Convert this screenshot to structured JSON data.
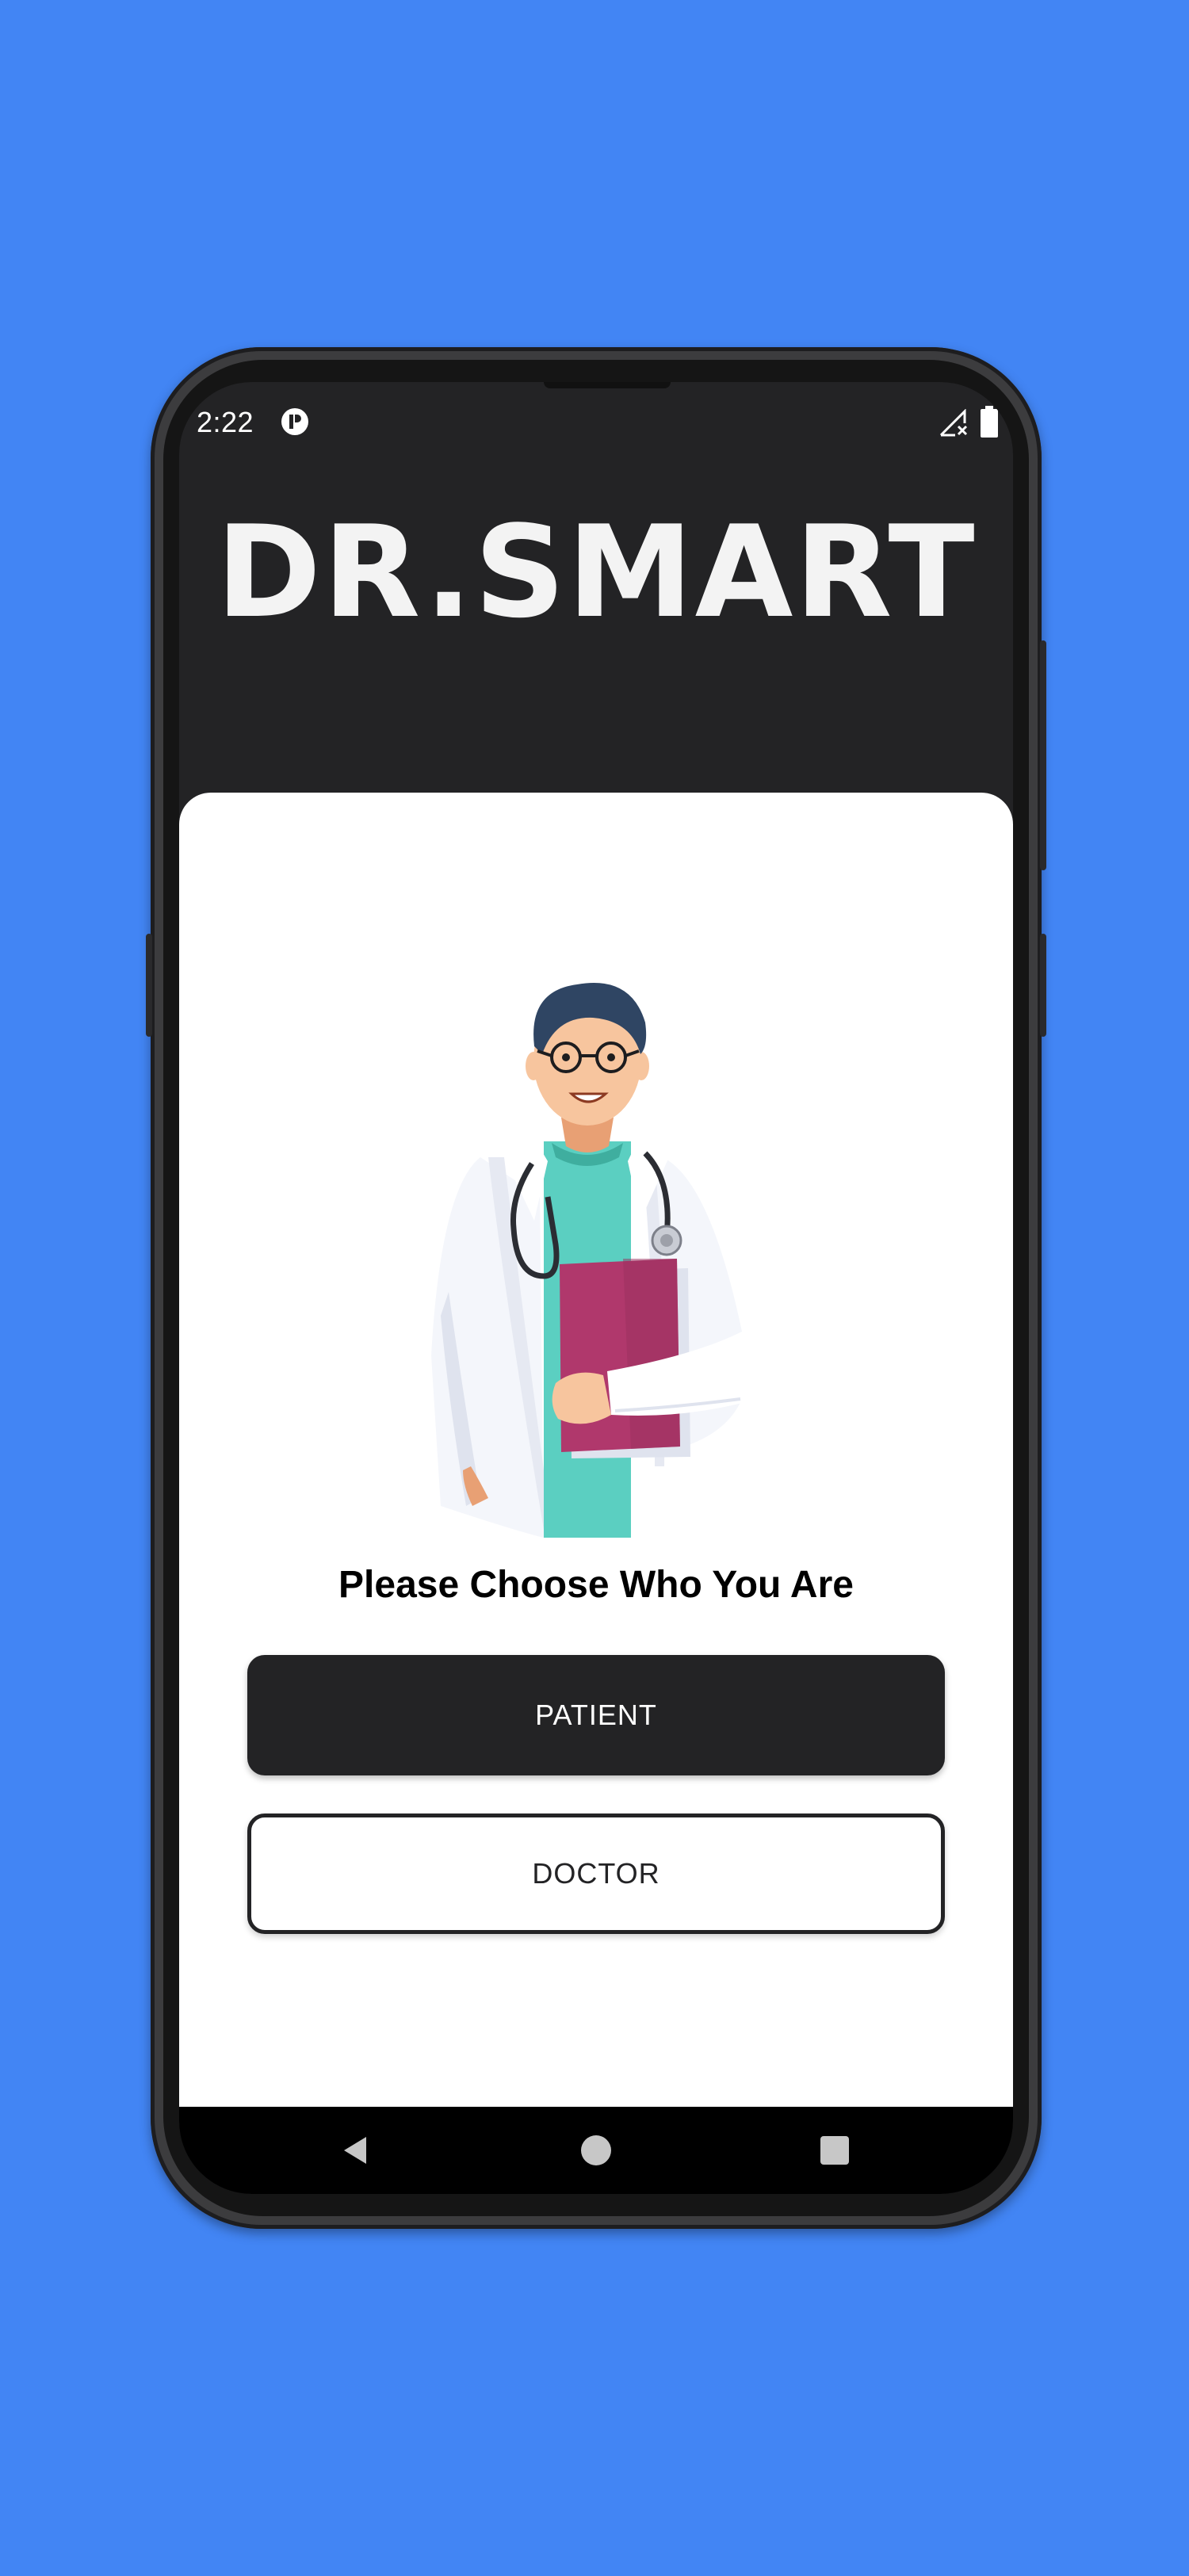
{
  "status_bar": {
    "time": "2:22",
    "icons": [
      "app-notification-icon",
      "no-signal-icon",
      "battery-icon"
    ]
  },
  "app": {
    "logo_text": "DR.SMART",
    "illustration": "doctor-with-clipboard-illustration"
  },
  "role_selection": {
    "title": "Please Choose Who You Are",
    "patient_label": "PATIENT",
    "doctor_label": "DOCTOR"
  },
  "navigation": {
    "icons": [
      "back-icon",
      "home-icon",
      "recents-icon"
    ]
  },
  "colors": {
    "page_background": "#4285f4",
    "app_dark": "#232325",
    "card_background": "#ffffff",
    "nav_bar": "#000000",
    "scrubs": "#5bcfc1",
    "clipboard": "#b0386c"
  }
}
